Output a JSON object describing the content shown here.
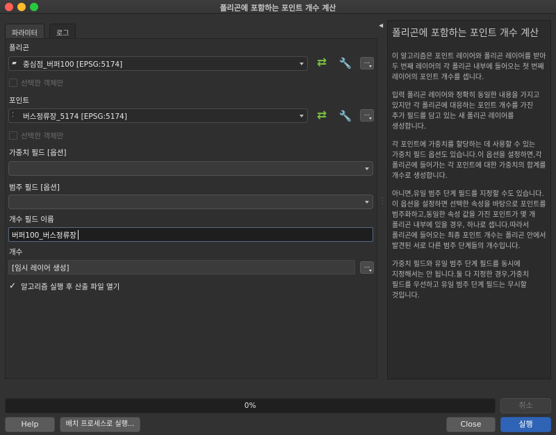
{
  "window": {
    "title": "폴리곤에 포함하는 포인트 개수 계산"
  },
  "tabs": [
    {
      "label": "파라미터"
    },
    {
      "label": "로그"
    }
  ],
  "params": {
    "polygon": {
      "label": "폴리곤",
      "value": "중심점_버퍼100 [EPSG:5174]",
      "selected_only_label": "선택한 객체만"
    },
    "points": {
      "label": "포인트",
      "value": "버스정류장_5174 [EPSG:5174]",
      "selected_only_label": "선택한 객체만"
    },
    "weight_field": {
      "label": "가중치 필드 [옵션]",
      "value": ""
    },
    "class_field": {
      "label": "범주 필드 [옵션]",
      "value": ""
    },
    "count_field_name": {
      "label": "개수 필드 이름",
      "value": "버퍼100_버스정류장"
    },
    "count_output": {
      "label": "개수",
      "value": "[임시 레이어 생성]"
    },
    "open_output": {
      "label": "알고리즘 실행 후 산출 파일 열기",
      "checked": true
    },
    "icons": {
      "polygon_layer": "polygon-layer-icon",
      "point_layer": "point-layer-icon",
      "iterate": "iterate-icon",
      "settings": "wrench-icon",
      "browse": "ellipsis-icon"
    }
  },
  "help": {
    "title": "폴리곤에 포함하는 포인트 개수 계산",
    "paragraphs": [
      "이 알고리즘은 포인트 레이어와 폴리곤 레이어를 받아 두 번째 레이어의 각 폴리곤 내부에 들어오는 첫 번째 레이어의 포인트 개수를 셉니다.",
      "입력 폴리곤 레이어와 정확히 동일한 내용을 가지고 있지만 각 폴리곤에 대응하는 포인트 개수를 가진 추가 필드를 담고 있는 새 폴리곤 레이어를 생성합니다.",
      "각 포인트에 가중치를 할당하는 데 사용할 수 있는 가중치 필드 옵션도 있습니다.이 옵션을 설정하면,각 폴리곤에 들어가는 각 포인트에 대한 가중치의 합계를 개수로 생성합니다.",
      "아니면,유일 범주 단계 필드를 지정할 수도 있습니다.이 옵션을 설정하면 선택한 속성을 바탕으로 포인트를 범주화하고,동일한 속성 값을 가진 포인트가 몇 개 폴리곤 내부에 있을 경우, 하나로 셉니다.따라서 폴리곤에 들어오는 최종 포인트 개수는 폴리곤 안에서 발견된 서로 다른 범주 단계들의 개수입니다.",
      "가중치 필드와 유일 범주 단계 필드를 동시에 지정해서는 안 됩니다.둘 다 지정한 경우,가중치 필드를 우선하고 유일 범주 단계 필드는 무시할 것입니다."
    ]
  },
  "progress": {
    "value": 0,
    "text": "0%"
  },
  "buttons": {
    "cancel": "취소",
    "help": "Help",
    "batch": "배치 프로세스로 실행...",
    "close": "Close",
    "run": "실행"
  },
  "colors": {
    "accent": "#2f63b6",
    "iterate_green": "#7bc043",
    "close_light": "#fe5f57",
    "min_light": "#febc2e",
    "max_light": "#28c840"
  }
}
